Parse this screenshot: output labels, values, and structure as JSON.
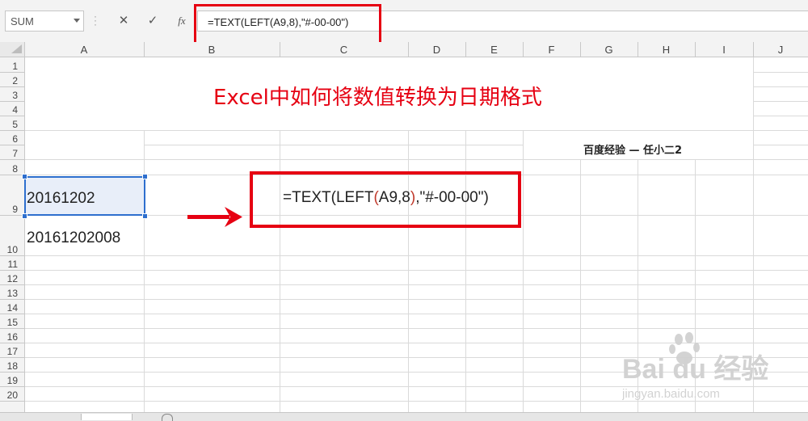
{
  "formula_bar": {
    "name_box": "SUM",
    "cancel_icon": "✕",
    "enter_icon": "✓",
    "fx_icon": "fx",
    "formula": "=TEXT(LEFT(A9,8),\"#-00-00\")"
  },
  "columns": [
    "A",
    "B",
    "C",
    "D",
    "E",
    "F",
    "G",
    "H",
    "I",
    "J"
  ],
  "rows": [
    "1",
    "2",
    "3",
    "4",
    "5",
    "6",
    "7",
    "8",
    "9",
    "10",
    "11",
    "12",
    "13",
    "14",
    "15",
    "16",
    "17",
    "18",
    "19",
    "20"
  ],
  "sheet": {
    "title": "Excel中如何将数值转换为日期格式",
    "author": "百度经验 — 任小二2",
    "a9": "20161202",
    "a10": "20161202008",
    "cell_formula": {
      "prefix": "=TEXT(LEFT",
      "open_paren": "(",
      "ref": "A9,8",
      "close_paren": ")",
      "suffix": ",\"#-00-00\")"
    }
  },
  "colors": {
    "accent_red": "#e60012",
    "selection_blue": "#2e6fce"
  },
  "watermark": {
    "logo": "Bai du 经验",
    "url": "jingyan.baidu.com"
  }
}
